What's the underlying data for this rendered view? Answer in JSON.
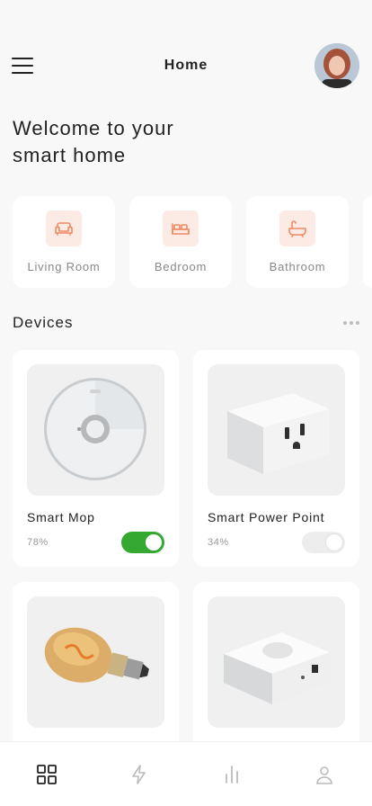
{
  "header": {
    "title": "Home"
  },
  "welcome": {
    "line1": "Welcome to your",
    "line2": "smart home"
  },
  "rooms": [
    {
      "label": "Living Room",
      "icon": "sofa-icon"
    },
    {
      "label": "Bedroom",
      "icon": "bed-icon"
    },
    {
      "label": "Bathroom",
      "icon": "bathtub-icon"
    }
  ],
  "devices_section": {
    "title": "Devices"
  },
  "devices": [
    {
      "name": "Smart Mop",
      "percent": "78%",
      "on": true
    },
    {
      "name": "Smart Power Point",
      "percent": "34%",
      "on": false
    },
    {
      "name": "",
      "percent": "",
      "on": false
    },
    {
      "name": "",
      "percent": "",
      "on": false
    }
  ],
  "nav": [
    {
      "icon": "grid-icon",
      "active": true
    },
    {
      "icon": "bolt-icon",
      "active": false
    },
    {
      "icon": "stats-icon",
      "active": false
    },
    {
      "icon": "user-icon",
      "active": false
    }
  ],
  "colors": {
    "accent": "#35a832",
    "room_icon": "#f08a65",
    "room_icon_bg": "#fbebe4"
  }
}
